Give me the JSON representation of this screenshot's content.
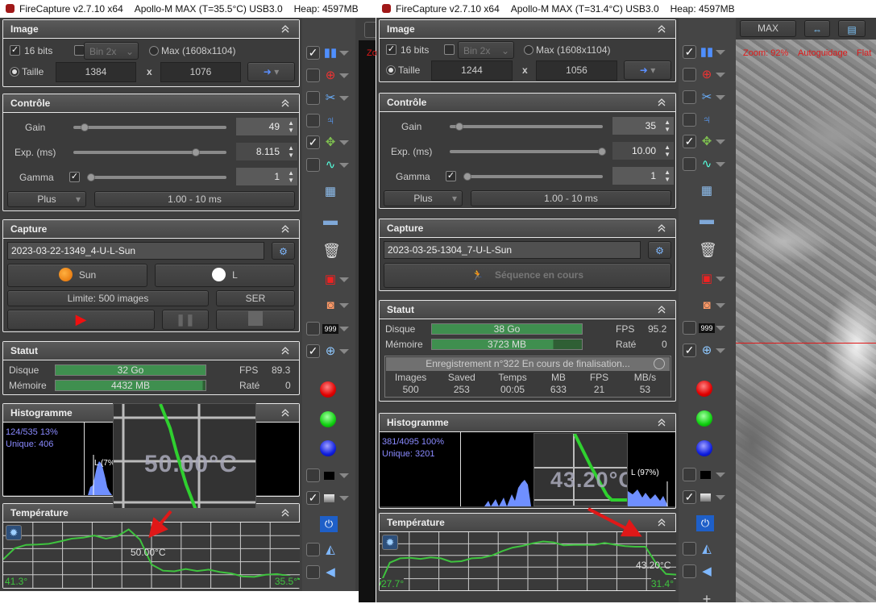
{
  "w1": {
    "titlebar": {
      "app": "FireCapture v2.7.10 x64",
      "camera": "Apollo-M MAX (T=35.5°C) USB3.0",
      "heap": "Heap: 4597MB"
    },
    "viewer_overlay": "Zo",
    "image": {
      "title": "Image",
      "bits_label": "16 bits",
      "bits_checked": true,
      "bin_checked": false,
      "bin_select": "Bin 2x",
      "max_label": "Max (1608x1104)",
      "taille_label": "Taille",
      "width": "1384",
      "x_label": "x",
      "height": "1076"
    },
    "controle": {
      "title": "Contrôle",
      "gain_label": "Gain",
      "gain": "49",
      "gain_pct": 4,
      "exp_label": "Exp. (ms)",
      "exp": "8.115",
      "exp_pct": 78,
      "gamma_label": "Gamma",
      "gamma_checked": true,
      "gamma": "1",
      "gamma_pct": 0,
      "plus": "Plus",
      "range": "1.00 - 10 ms"
    },
    "capture": {
      "title": "Capture",
      "filename": "2023-03-22-1349_4-U-L-Sun",
      "object": "Sun",
      "filter": "L",
      "limit": "Limite: 500 images",
      "format": "SER"
    },
    "statut": {
      "title": "Statut",
      "disk_label": "Disque",
      "disk": "32 Go",
      "mem_label": "Mémoire",
      "mem": "4432 MB",
      "mem_pct": 98,
      "fps_label": "FPS",
      "fps": "89.3",
      "missed_label": "Raté",
      "missed": "0"
    },
    "histogram": {
      "title": "Histogramme",
      "stats": "124/535 13%",
      "unique": "Unique: 406",
      "channel": "L (7%"
    },
    "temperature": {
      "title": "Température",
      "start": "41.3°",
      "end": "35.5°",
      "marker": "50.00°C",
      "inset": "50.00°C"
    }
  },
  "w2": {
    "titlebar": {
      "app": "FireCapture v2.7.10 x64",
      "camera": "Apollo-M MAX (T=31.4°C) USB3.0",
      "heap": "Heap: 4597MB"
    },
    "image": {
      "title": "Image",
      "bits_label": "16 bits",
      "bits_checked": true,
      "bin_checked": false,
      "bin_select": "Bin 2x",
      "max_label": "Max (1608x1104)",
      "taille_label": "Taille",
      "width": "1244",
      "x_label": "x",
      "height": "1056"
    },
    "controle": {
      "title": "Contrôle",
      "gain_label": "Gain",
      "gain": "35",
      "gain_pct": 3,
      "exp_label": "Exp. (ms)",
      "exp": "10.00",
      "exp_pct": 100,
      "gamma_label": "Gamma",
      "gamma_checked": true,
      "gamma": "1",
      "gamma_pct": 0,
      "plus": "Plus",
      "range": "1.00 - 10 ms"
    },
    "capture": {
      "title": "Capture",
      "filename": "2023-03-25-1304_7-U-L-Sun",
      "sequence": "Séquence en cours"
    },
    "statut": {
      "title": "Statut",
      "disk_label": "Disque",
      "disk": "38 Go",
      "mem_label": "Mémoire",
      "mem": "3723 MB",
      "mem_pct": 81,
      "fps_label": "FPS",
      "fps": "95.2",
      "missed_label": "Raté",
      "missed": "0",
      "recording": "Enregistrement n°322   En cours de finalisation...",
      "table_headers": [
        "Images",
        "Saved",
        "Temps",
        "MB",
        "FPS",
        "MB/s"
      ],
      "table_values": [
        "500",
        "253",
        "00:05",
        "633",
        "21",
        "53"
      ]
    },
    "histogram": {
      "title": "Histogramme",
      "stats": "381/4095 100%",
      "unique": "Unique: 3201",
      "channel": "L (97%)"
    },
    "temperature": {
      "title": "Température",
      "start": "27.7°",
      "end": "31.4°",
      "marker": "43.20°C",
      "inset": "43.20°C"
    }
  },
  "viewer": {
    "max_button": "MAX",
    "zoom": "Zoom: 92%",
    "autoguide": "Autoguidage",
    "flat": "Flat"
  },
  "chart_data": [
    {
      "type": "line",
      "title": "Température",
      "ylim": [
        33,
        52
      ],
      "start_label": "41.3°",
      "end_label": "35.5°",
      "annotation": "50.00°C",
      "values": [
        41.3,
        44.5,
        45.5,
        45.6,
        45.8,
        46.5,
        47.3,
        47.6,
        48.2,
        47.3,
        48.0,
        50.0,
        47.0,
        39.8,
        38.0,
        37.8,
        38.5,
        37.9,
        38.3,
        37.6,
        37.2,
        36.3,
        36.2,
        36.8,
        37.0,
        36.5,
        35.5
      ]
    },
    {
      "type": "line",
      "title": "Température",
      "ylim": [
        26,
        46
      ],
      "start_label": "27.7°",
      "end_label": "31.4°",
      "annotation": "43.20°C",
      "values": [
        27.7,
        35.5,
        37.0,
        37.2,
        36.8,
        37.3,
        37.0,
        35.8,
        36.0,
        37.0,
        37.2,
        38.0,
        39.5,
        40.7,
        41.3,
        42.2,
        42.8,
        42.5,
        41.5,
        41.6,
        41.6,
        41.6,
        42.3,
        41.7,
        41.2,
        41.0,
        41.0,
        35.5,
        31.6,
        31.4
      ]
    }
  ],
  "colors": {
    "accent_green": "#3ec33e",
    "progress_green": "#3f8f4f",
    "histogram_blue": "#6f8fff",
    "annotation_red": "#e01818"
  }
}
